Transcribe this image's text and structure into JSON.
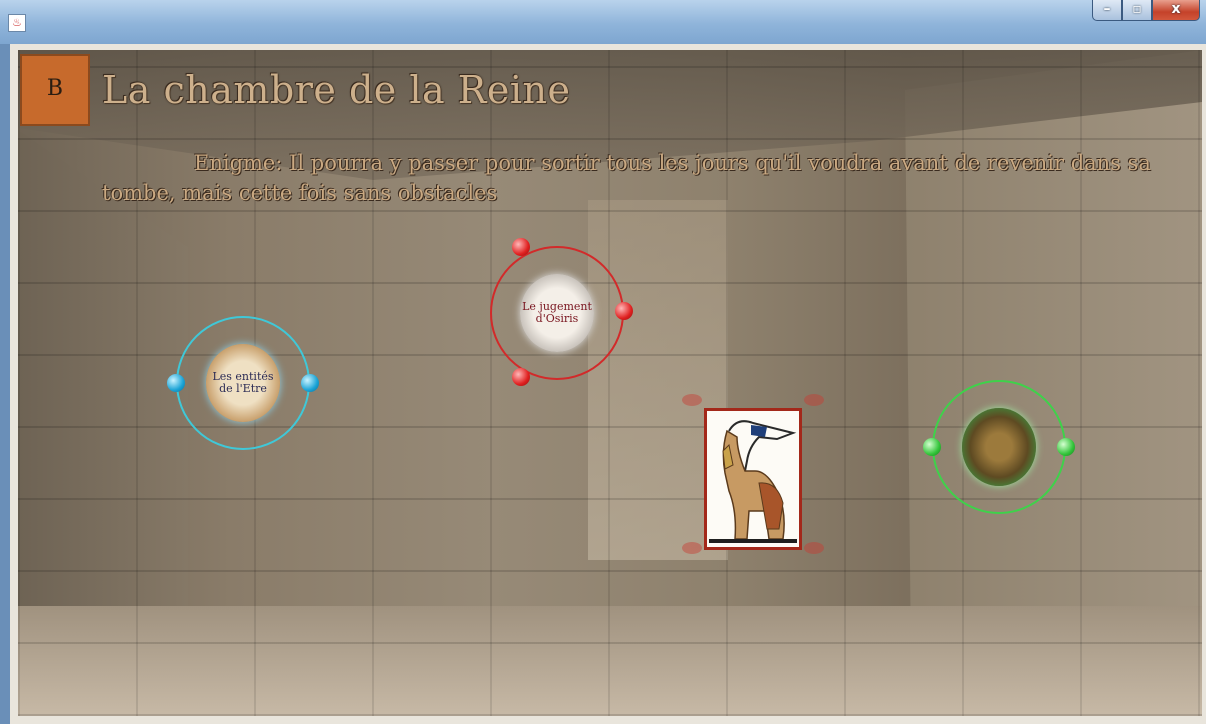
{
  "window": {
    "app_icon": "java-icon",
    "buttons": {
      "minimize": "–",
      "maximize": "▫",
      "close": "x"
    }
  },
  "level": {
    "label": "B"
  },
  "room": {
    "title": "La chambre de la Reine",
    "riddle": "Enigme: Il pourra y passer pour sortir tous les jours qu'il voudra avant de revenir dans sa tombe, mais cette fois sans obstacles"
  },
  "items": [
    {
      "label": "Les entités de l'Etre",
      "color": "#3fc8d8"
    },
    {
      "label": "Le jugement d'Osiris",
      "color": "#d22a2a"
    },
    {
      "label": "",
      "color": "#3ed24a"
    }
  ],
  "colors": {
    "accent": "#c76a2c",
    "title_text": "#cdb08c",
    "portrait_border": "#a3281a"
  }
}
